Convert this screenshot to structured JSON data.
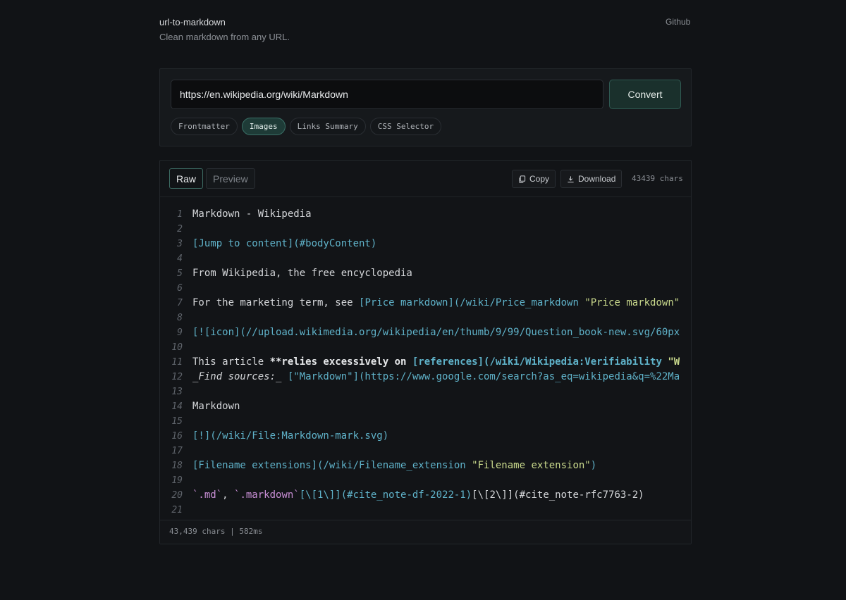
{
  "header": {
    "title": "url-to-markdown",
    "subtitle": "Clean markdown from any URL.",
    "github_label": "Github"
  },
  "input": {
    "url_value": "https://en.wikipedia.org/wiki/Markdown",
    "convert_label": "Convert",
    "options": [
      {
        "label": "Frontmatter",
        "active": false
      },
      {
        "label": "Images",
        "active": true
      },
      {
        "label": "Links Summary",
        "active": false
      },
      {
        "label": "CSS Selector",
        "active": false
      }
    ]
  },
  "output": {
    "tabs": [
      {
        "label": "Raw",
        "active": true
      },
      {
        "label": "Preview",
        "active": false
      }
    ],
    "copy_label": "Copy",
    "download_label": "Download",
    "char_count": "43439 chars",
    "status": "43,439 chars | 582ms",
    "lines": [
      {
        "n": "1",
        "segs": [
          [
            "t",
            "Markdown - Wikipedia"
          ]
        ]
      },
      {
        "n": "2",
        "segs": []
      },
      {
        "n": "3",
        "segs": [
          [
            "link",
            "[Jump to content](#bodyContent)"
          ]
        ]
      },
      {
        "n": "4",
        "segs": []
      },
      {
        "n": "5",
        "segs": [
          [
            "t",
            "From Wikipedia, the free encyclopedia"
          ]
        ]
      },
      {
        "n": "6",
        "segs": []
      },
      {
        "n": "7",
        "segs": [
          [
            "t",
            "For the marketing term, see "
          ],
          [
            "link",
            "[Price markdown](/wiki/Price_markdown "
          ],
          [
            "str",
            "\"Price markdown\""
          ]
        ]
      },
      {
        "n": "8",
        "segs": []
      },
      {
        "n": "9",
        "segs": [
          [
            "link",
            "[![icon](//upload.wikimedia.org/wikipedia/en/thumb/9/99/Question_book-new.svg/60px"
          ]
        ]
      },
      {
        "n": "10",
        "segs": []
      },
      {
        "n": "11",
        "segs": [
          [
            "t",
            "This article "
          ],
          [
            "bold",
            "**relies excessively on "
          ],
          [
            "boldlink",
            "[references](/wiki/Wikipedia:Verifiability "
          ],
          [
            "boldstr",
            "\"W"
          ]
        ]
      },
      {
        "n": "12",
        "segs": [
          [
            "it",
            "_Find sources:_ "
          ],
          [
            "link",
            "[\"Markdown\"](https://www.google.com/search?as_eq=wikipedia&q=%22Ma"
          ]
        ]
      },
      {
        "n": "13",
        "segs": []
      },
      {
        "n": "14",
        "segs": [
          [
            "t",
            "Markdown"
          ]
        ]
      },
      {
        "n": "15",
        "segs": []
      },
      {
        "n": "16",
        "segs": [
          [
            "link",
            "[!](/wiki/File:Markdown-mark.svg)"
          ]
        ]
      },
      {
        "n": "17",
        "segs": []
      },
      {
        "n": "18",
        "segs": [
          [
            "link",
            "[Filename extensions](/wiki/Filename_extension "
          ],
          [
            "str",
            "\"Filename extension\""
          ],
          [
            "link",
            ")"
          ]
        ]
      },
      {
        "n": "19",
        "segs": []
      },
      {
        "n": "20",
        "segs": [
          [
            "code",
            "`.md`"
          ],
          [
            "t",
            ", "
          ],
          [
            "code",
            "`.markdown`"
          ],
          [
            "link",
            "[\\[1\\]](#cite_note-df-2022-1)"
          ],
          [
            "t",
            "[\\[2\\]](#cite_note-rfc7763-2)"
          ]
        ]
      },
      {
        "n": "21",
        "segs": []
      }
    ]
  }
}
